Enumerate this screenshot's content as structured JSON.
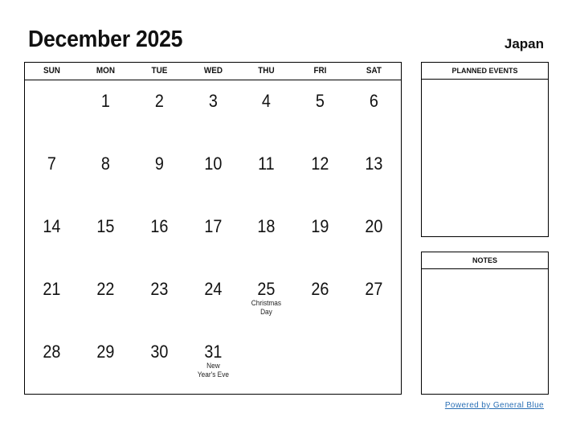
{
  "header": {
    "title": "December 2025",
    "country": "Japan"
  },
  "weekdays": [
    "SUN",
    "MON",
    "TUE",
    "WED",
    "THU",
    "FRI",
    "SAT"
  ],
  "weeks": [
    [
      {
        "d": ""
      },
      {
        "d": "1"
      },
      {
        "d": "2"
      },
      {
        "d": "3"
      },
      {
        "d": "4"
      },
      {
        "d": "5"
      },
      {
        "d": "6"
      }
    ],
    [
      {
        "d": "7"
      },
      {
        "d": "8"
      },
      {
        "d": "9"
      },
      {
        "d": "10"
      },
      {
        "d": "11"
      },
      {
        "d": "12"
      },
      {
        "d": "13"
      }
    ],
    [
      {
        "d": "14"
      },
      {
        "d": "15"
      },
      {
        "d": "16"
      },
      {
        "d": "17"
      },
      {
        "d": "18"
      },
      {
        "d": "19"
      },
      {
        "d": "20"
      }
    ],
    [
      {
        "d": "21"
      },
      {
        "d": "22"
      },
      {
        "d": "23"
      },
      {
        "d": "24"
      },
      {
        "d": "25",
        "h": "Christmas Day"
      },
      {
        "d": "26"
      },
      {
        "d": "27"
      }
    ],
    [
      {
        "d": "28"
      },
      {
        "d": "29"
      },
      {
        "d": "30"
      },
      {
        "d": "31",
        "h": "New Year's Eve"
      },
      {
        "d": ""
      },
      {
        "d": ""
      },
      {
        "d": ""
      }
    ]
  ],
  "side": {
    "planned_events": "PLANNED EVENTS",
    "notes": "NOTES"
  },
  "footer": {
    "powered_by": "Powered by General Blue",
    "link_color": "#2a6fb5"
  }
}
